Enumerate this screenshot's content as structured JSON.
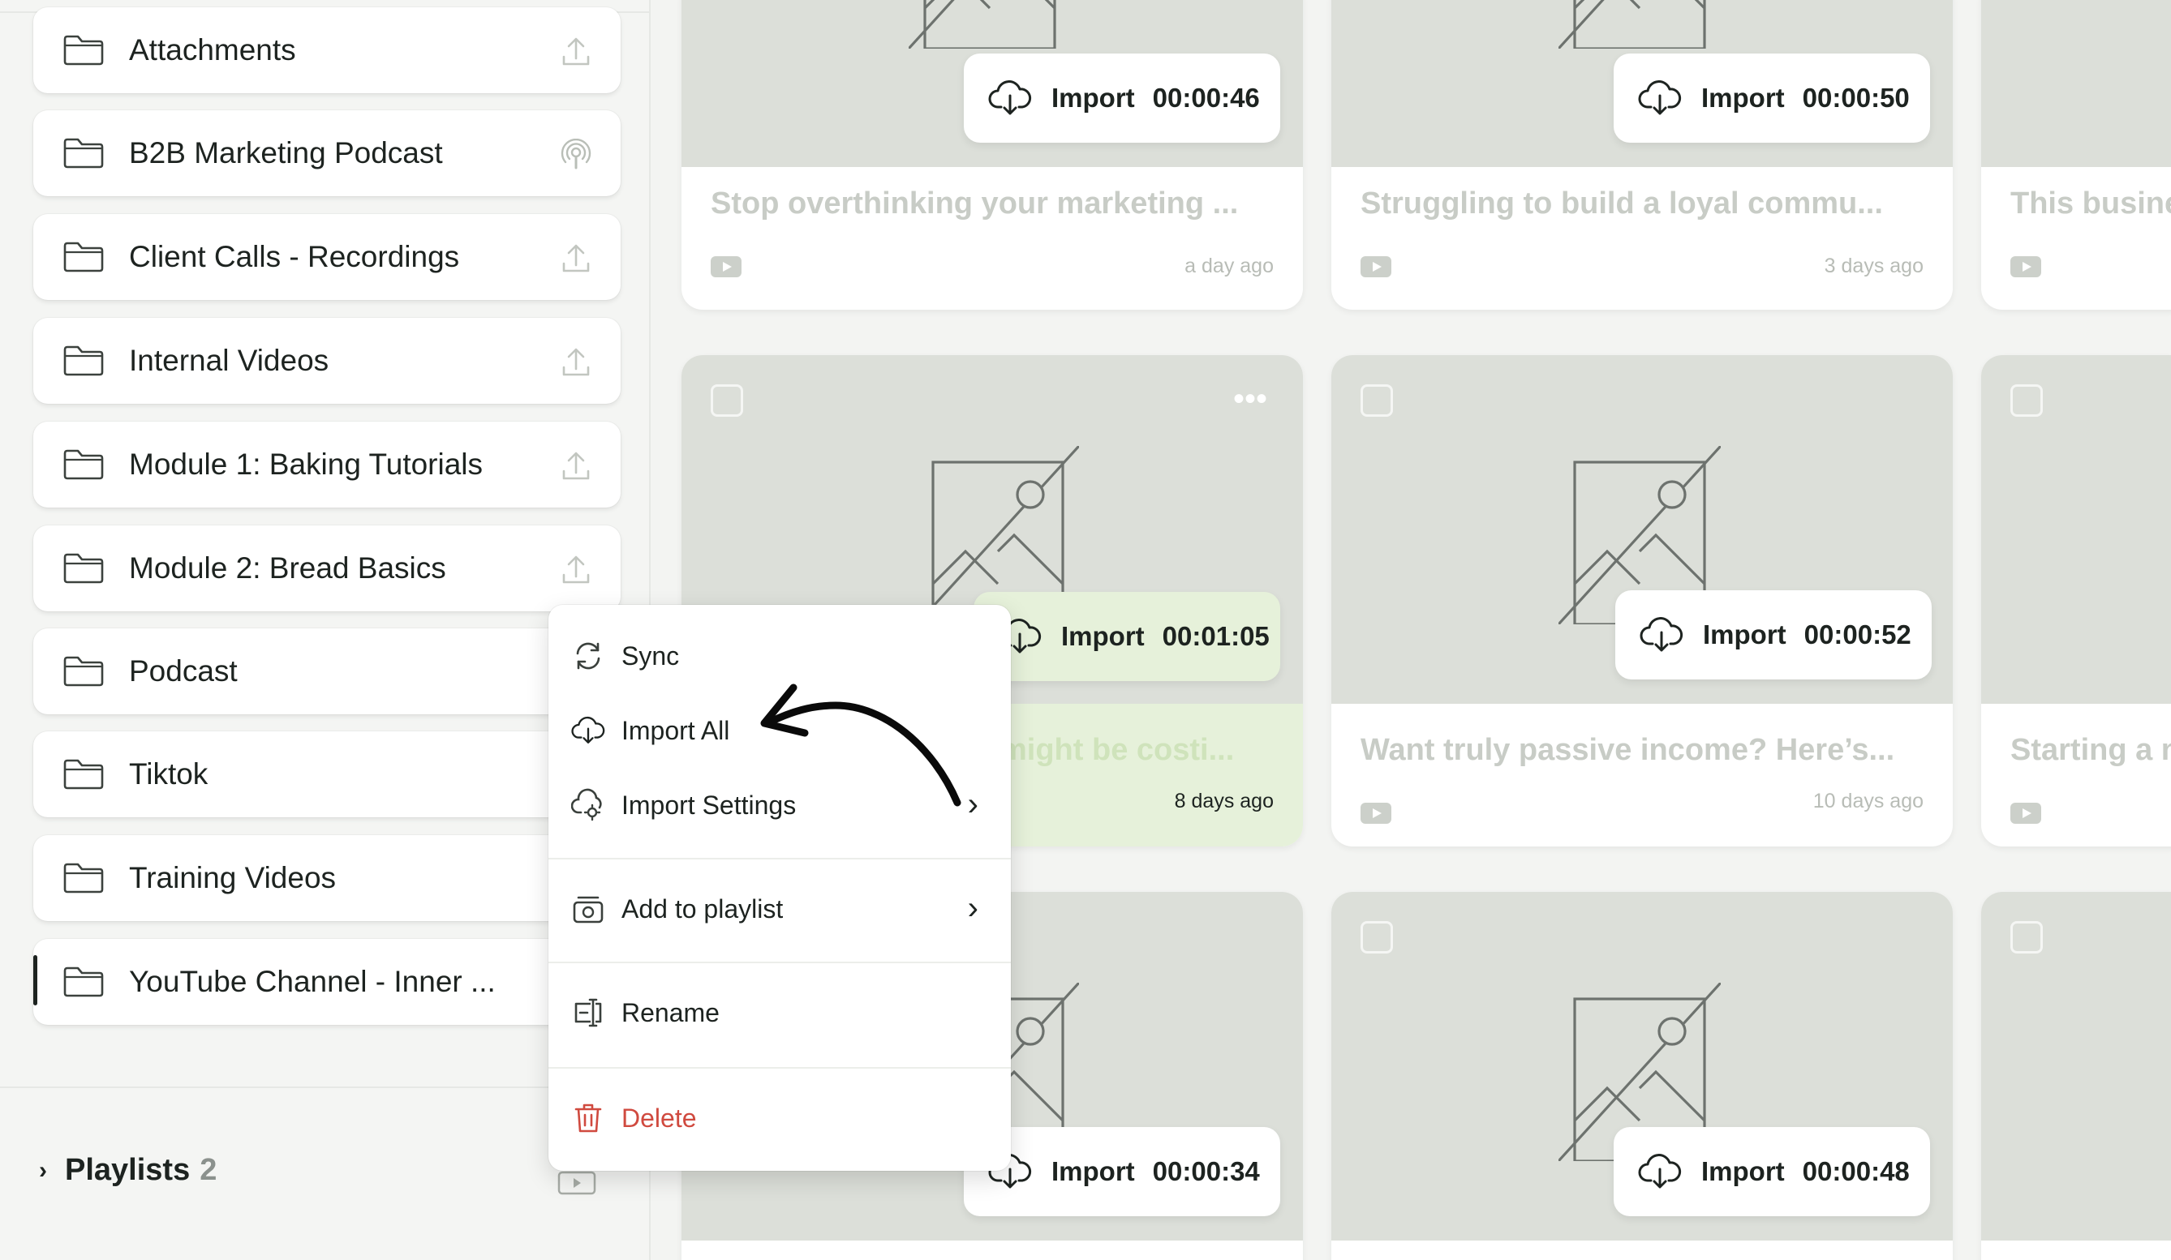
{
  "sidebar": {
    "folders": [
      {
        "label": "Attachments",
        "icon": "upload-icon"
      },
      {
        "label": "B2B Marketing Podcast",
        "icon": "podcast-icon"
      },
      {
        "label": "Client Calls - Recordings",
        "icon": "upload-icon"
      },
      {
        "label": "Internal Videos",
        "icon": "upload-icon"
      },
      {
        "label": "Module 1: Baking Tutorials",
        "icon": "upload-icon"
      },
      {
        "label": "Module 2: Bread Basics",
        "icon": "upload-icon"
      },
      {
        "label": "Podcast",
        "icon": ""
      },
      {
        "label": "Tiktok",
        "icon": ""
      },
      {
        "label": "Training Videos",
        "icon": ""
      },
      {
        "label": "YouTube Channel - Inner ...",
        "icon": ""
      }
    ],
    "playlists": {
      "label": "Playlists",
      "count": "2"
    }
  },
  "cards": [
    {
      "import_label": "Import",
      "duration": "00:00:46",
      "title": "Stop overthinking your marketing ...",
      "ago": "a day ago"
    },
    {
      "import_label": "Import",
      "duration": "00:00:50",
      "title": "Struggling to build a loyal commu...",
      "ago": "3 days ago"
    },
    {
      "title": "This busine"
    },
    {
      "import_label": "Import",
      "duration": "00:01:05",
      "title": "might be costi...",
      "ago": "8 days ago"
    },
    {
      "import_label": "Import",
      "duration": "00:00:52",
      "title": "Want truly passive income? Here’s...",
      "ago": "10 days ago"
    },
    {
      "title": "Starting a n"
    },
    {
      "import_label": "Import",
      "duration": "00:00:34"
    },
    {
      "import_label": "Import",
      "duration": "00:00:48"
    }
  ],
  "menu": {
    "sync": "Sync",
    "import_all": "Import All",
    "import_settings": "Import Settings",
    "add_to_playlist": "Add to playlist",
    "rename": "Rename",
    "delete": "Delete"
  },
  "colors": {
    "accent_highlight": "#e6f1da",
    "danger": "#d04a3f",
    "thumb_bg": "#dcdfd9"
  }
}
